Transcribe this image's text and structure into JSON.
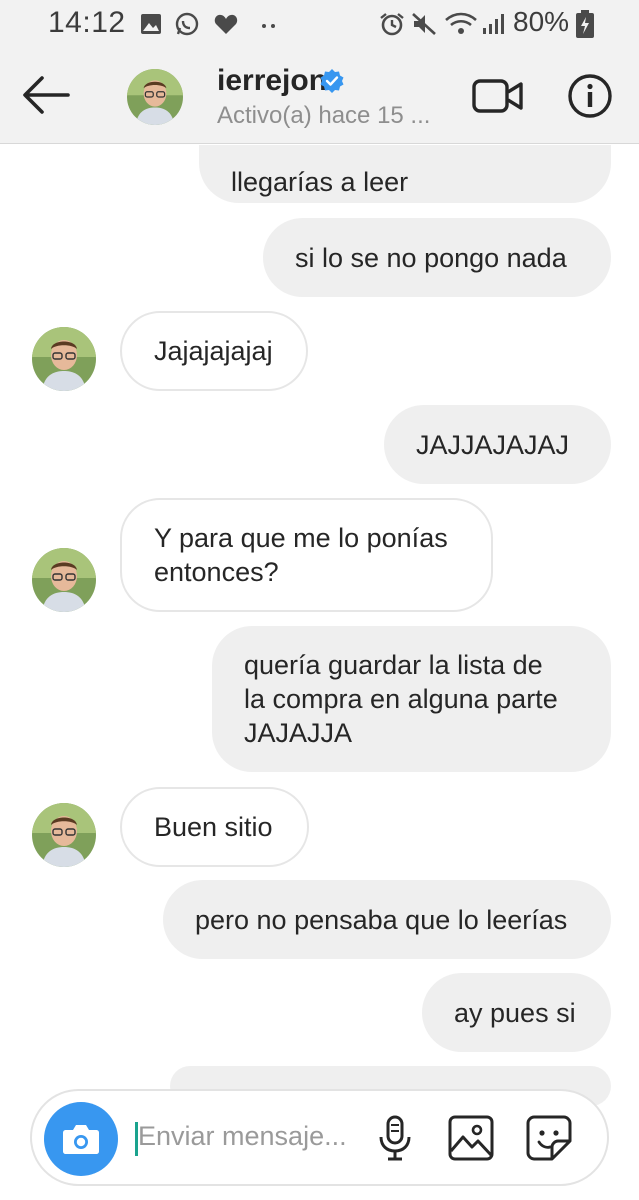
{
  "status_bar": {
    "time": "14:12",
    "battery": "80%",
    "left_icons": [
      "gallery-icon",
      "whatsapp-icon",
      "heart-icon",
      "more-dots-icon"
    ],
    "right_icons": [
      "alarm-icon",
      "mute-icon",
      "wifi-icon",
      "signal-icon",
      "battery-charging-icon"
    ]
  },
  "header": {
    "username": "ierrejon",
    "activity": "Activo(a) hace 15 ...",
    "verified": true
  },
  "messages": [
    {
      "side": "received",
      "text": "llegarías a leer",
      "partial": true
    },
    {
      "side": "sent",
      "text": "si lo se no pongo nada"
    },
    {
      "side": "received",
      "text": "Jajajajajaj"
    },
    {
      "side": "sent",
      "text": "JAJJAJAJAJ"
    },
    {
      "side": "received",
      "lines": [
        "Y para que me lo ponías",
        "entonces?"
      ]
    },
    {
      "side": "sent",
      "lines": [
        "quería guardar la lista de",
        "la compra en alguna parte",
        "JAJAJJA"
      ]
    },
    {
      "side": "received",
      "text": "Buen sitio"
    },
    {
      "side": "sent",
      "text": "pero no pensaba que lo leerías"
    },
    {
      "side": "sent",
      "text": "ay pues si"
    }
  ],
  "composer": {
    "placeholder": "Enviar mensaje..."
  },
  "colors": {
    "accent": "#3897f0",
    "verified": "#3897f0",
    "sent_bubble": "#efefef",
    "bar_bg": "#f2f2f2"
  }
}
